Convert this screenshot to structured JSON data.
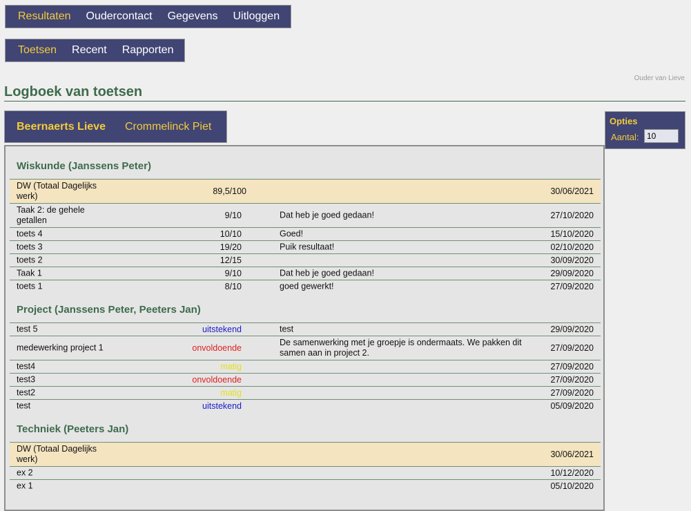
{
  "nav_main": [
    {
      "label": "Resultaten",
      "active": true
    },
    {
      "label": "Oudercontact",
      "active": false
    },
    {
      "label": "Gegevens",
      "active": false
    },
    {
      "label": "Uitloggen",
      "active": false
    }
  ],
  "nav_sub": [
    {
      "label": "Toetsen",
      "active": true
    },
    {
      "label": "Recent",
      "active": false
    },
    {
      "label": "Rapporten",
      "active": false
    }
  ],
  "user_label": "Ouder van Lieve",
  "page_title": "Logboek van toetsen",
  "children": [
    {
      "name": "Beernaerts Lieve",
      "active": true
    },
    {
      "name": "Crommelinck Piet",
      "active": false
    }
  ],
  "options": {
    "title": "Opties",
    "count_label": "Aantal:",
    "count_value": "10"
  },
  "courses": [
    {
      "title": "Wiskunde (Janssens Peter)",
      "rows": [
        {
          "name": "DW (Totaal Dagelijks werk)",
          "score": "89,5/100",
          "comment": "",
          "date": "30/06/2021",
          "summary": true
        },
        {
          "name": "Taak 2: de gehele getallen",
          "score": "9/10",
          "comment": "Dat heb je goed gedaan!",
          "date": "27/10/2020"
        },
        {
          "name": "toets 4",
          "score": "10/10",
          "comment": "Goed!",
          "date": "15/10/2020"
        },
        {
          "name": "toets 3",
          "score": "19/20",
          "comment": "Puik resultaat!",
          "date": "02/10/2020"
        },
        {
          "name": "toets 2",
          "score": "12/15",
          "comment": "",
          "date": "30/09/2020"
        },
        {
          "name": "Taak 1",
          "score": "9/10",
          "comment": "Dat heb je goed gedaan!",
          "date": "29/09/2020"
        },
        {
          "name": "toets 1",
          "score": "8/10",
          "comment": "goed gewerkt!",
          "date": "27/09/2020"
        }
      ]
    },
    {
      "title": "Project (Janssens Peter, Peeters Jan)",
      "rows": [
        {
          "name": "test 5",
          "score": "uitstekend",
          "grade": "uitstekend",
          "comment": "test",
          "date": "29/09/2020"
        },
        {
          "name": "medewerking project 1",
          "score": "onvoldoende",
          "grade": "onvoldoende",
          "comment": "De samenwerking met je groepje is ondermaats. We pakken dit samen aan in project 2.",
          "date": "27/09/2020"
        },
        {
          "name": "test4",
          "score": "matig",
          "grade": "matig",
          "comment": "",
          "date": "27/09/2020"
        },
        {
          "name": "test3",
          "score": "onvoldoende",
          "grade": "onvoldoende",
          "comment": "",
          "date": "27/09/2020"
        },
        {
          "name": "test2",
          "score": "matig",
          "grade": "matig",
          "comment": "",
          "date": "27/09/2020"
        },
        {
          "name": "test",
          "score": "uitstekend",
          "grade": "uitstekend",
          "comment": "",
          "date": "05/09/2020"
        }
      ]
    },
    {
      "title": "Techniek (Peeters Jan)",
      "rows": [
        {
          "name": "DW (Totaal Dagelijks werk)",
          "score": "",
          "comment": "",
          "date": "30/06/2021",
          "summary": true
        },
        {
          "name": "ex 2",
          "score": "",
          "comment": "",
          "date": "10/12/2020"
        },
        {
          "name": "ex 1",
          "score": "",
          "comment": "",
          "date": "05/10/2020"
        }
      ]
    }
  ]
}
